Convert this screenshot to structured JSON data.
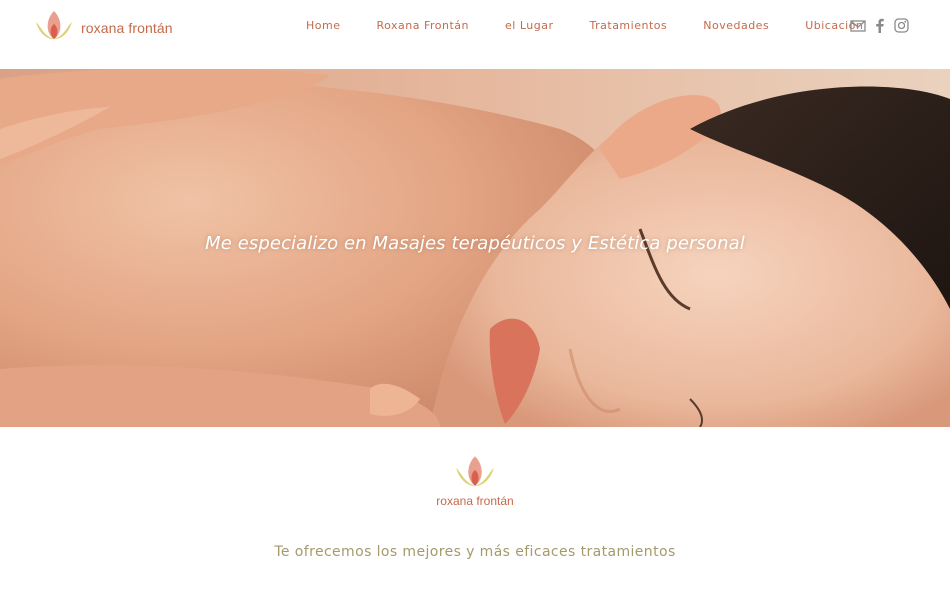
{
  "brand": {
    "name": "roxana frontán",
    "logo_icon": "lotus-icon",
    "colors": {
      "primary": "#c56a4b",
      "lotus_yellow": "#dcd27a",
      "lotus_pink": "#e9a08f",
      "tagline": "#a49a6c"
    }
  },
  "nav": {
    "items": [
      {
        "label": "Home"
      },
      {
        "label": "Roxana Frontán"
      },
      {
        "label": "el Lugar"
      },
      {
        "label": "Tratamientos"
      },
      {
        "label": "Novedades"
      },
      {
        "label": "Ubicación"
      }
    ]
  },
  "social": {
    "icons": [
      "mail-icon",
      "facebook-icon",
      "instagram-icon"
    ]
  },
  "hero": {
    "tagline": "Me especializo en Masajes terapéuticos y Estética personal"
  },
  "section": {
    "logo_text": "roxana frontán",
    "offer": "Te ofrecemos los mejores y más eficaces tratamientos"
  }
}
